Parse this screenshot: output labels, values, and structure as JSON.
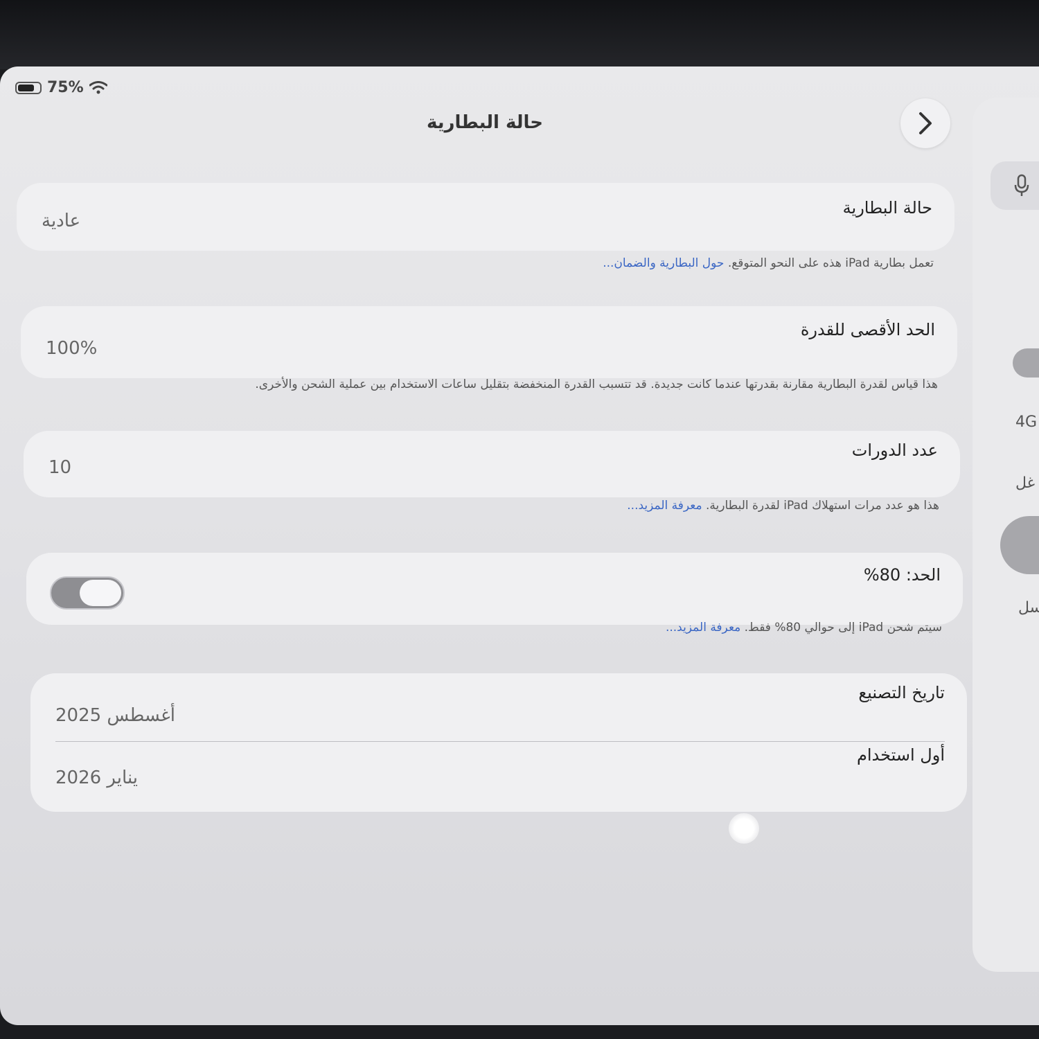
{
  "status_bar": {
    "battery_percent": "75%"
  },
  "nav": {
    "title": "حالة البطارية"
  },
  "battery_health": {
    "label": "حالة البطارية",
    "value": "عادية",
    "footnote_text": "تعمل بطارية iPad هذه على النحو المتوقع. ",
    "footnote_link": "حول البطارية والضمان..."
  },
  "max_capacity": {
    "label": "الحد الأقصى للقدرة",
    "value": "100%",
    "footnote_text": "هذا قياس لقدرة البطارية مقارنة بقدرتها عندما كانت جديدة. قد تتسبب القدرة المنخفضة بتقليل ساعات الاستخدام بين عملية الشحن والأخرى."
  },
  "cycle_count": {
    "label": "عدد الدورات",
    "value": "10",
    "footnote_text": "هذا هو عدد مرات استهلاك iPad لقدرة البطارية. ",
    "footnote_link": "معرفة المزيد..."
  },
  "charge_limit": {
    "label": "الحد: 80%",
    "toggle_on": true,
    "footnote_text": "سيتم شحن iPad إلى حوالي 80% فقط. ",
    "footnote_link": "معرفة المزيد..."
  },
  "dates": {
    "manufacture_label": "تاريخ التصنيع",
    "manufacture_value": "أغسطس 2025",
    "first_use_label": "أول استخدام",
    "first_use_value": "يناير 2026"
  },
  "side_panel": {
    "item_4g": "4G",
    "item_a": "غل",
    "item_b": "سل"
  },
  "colors": {
    "link": "#3a66c4",
    "card": "#f0f0f2",
    "toggle_track": "#8e8e92"
  }
}
